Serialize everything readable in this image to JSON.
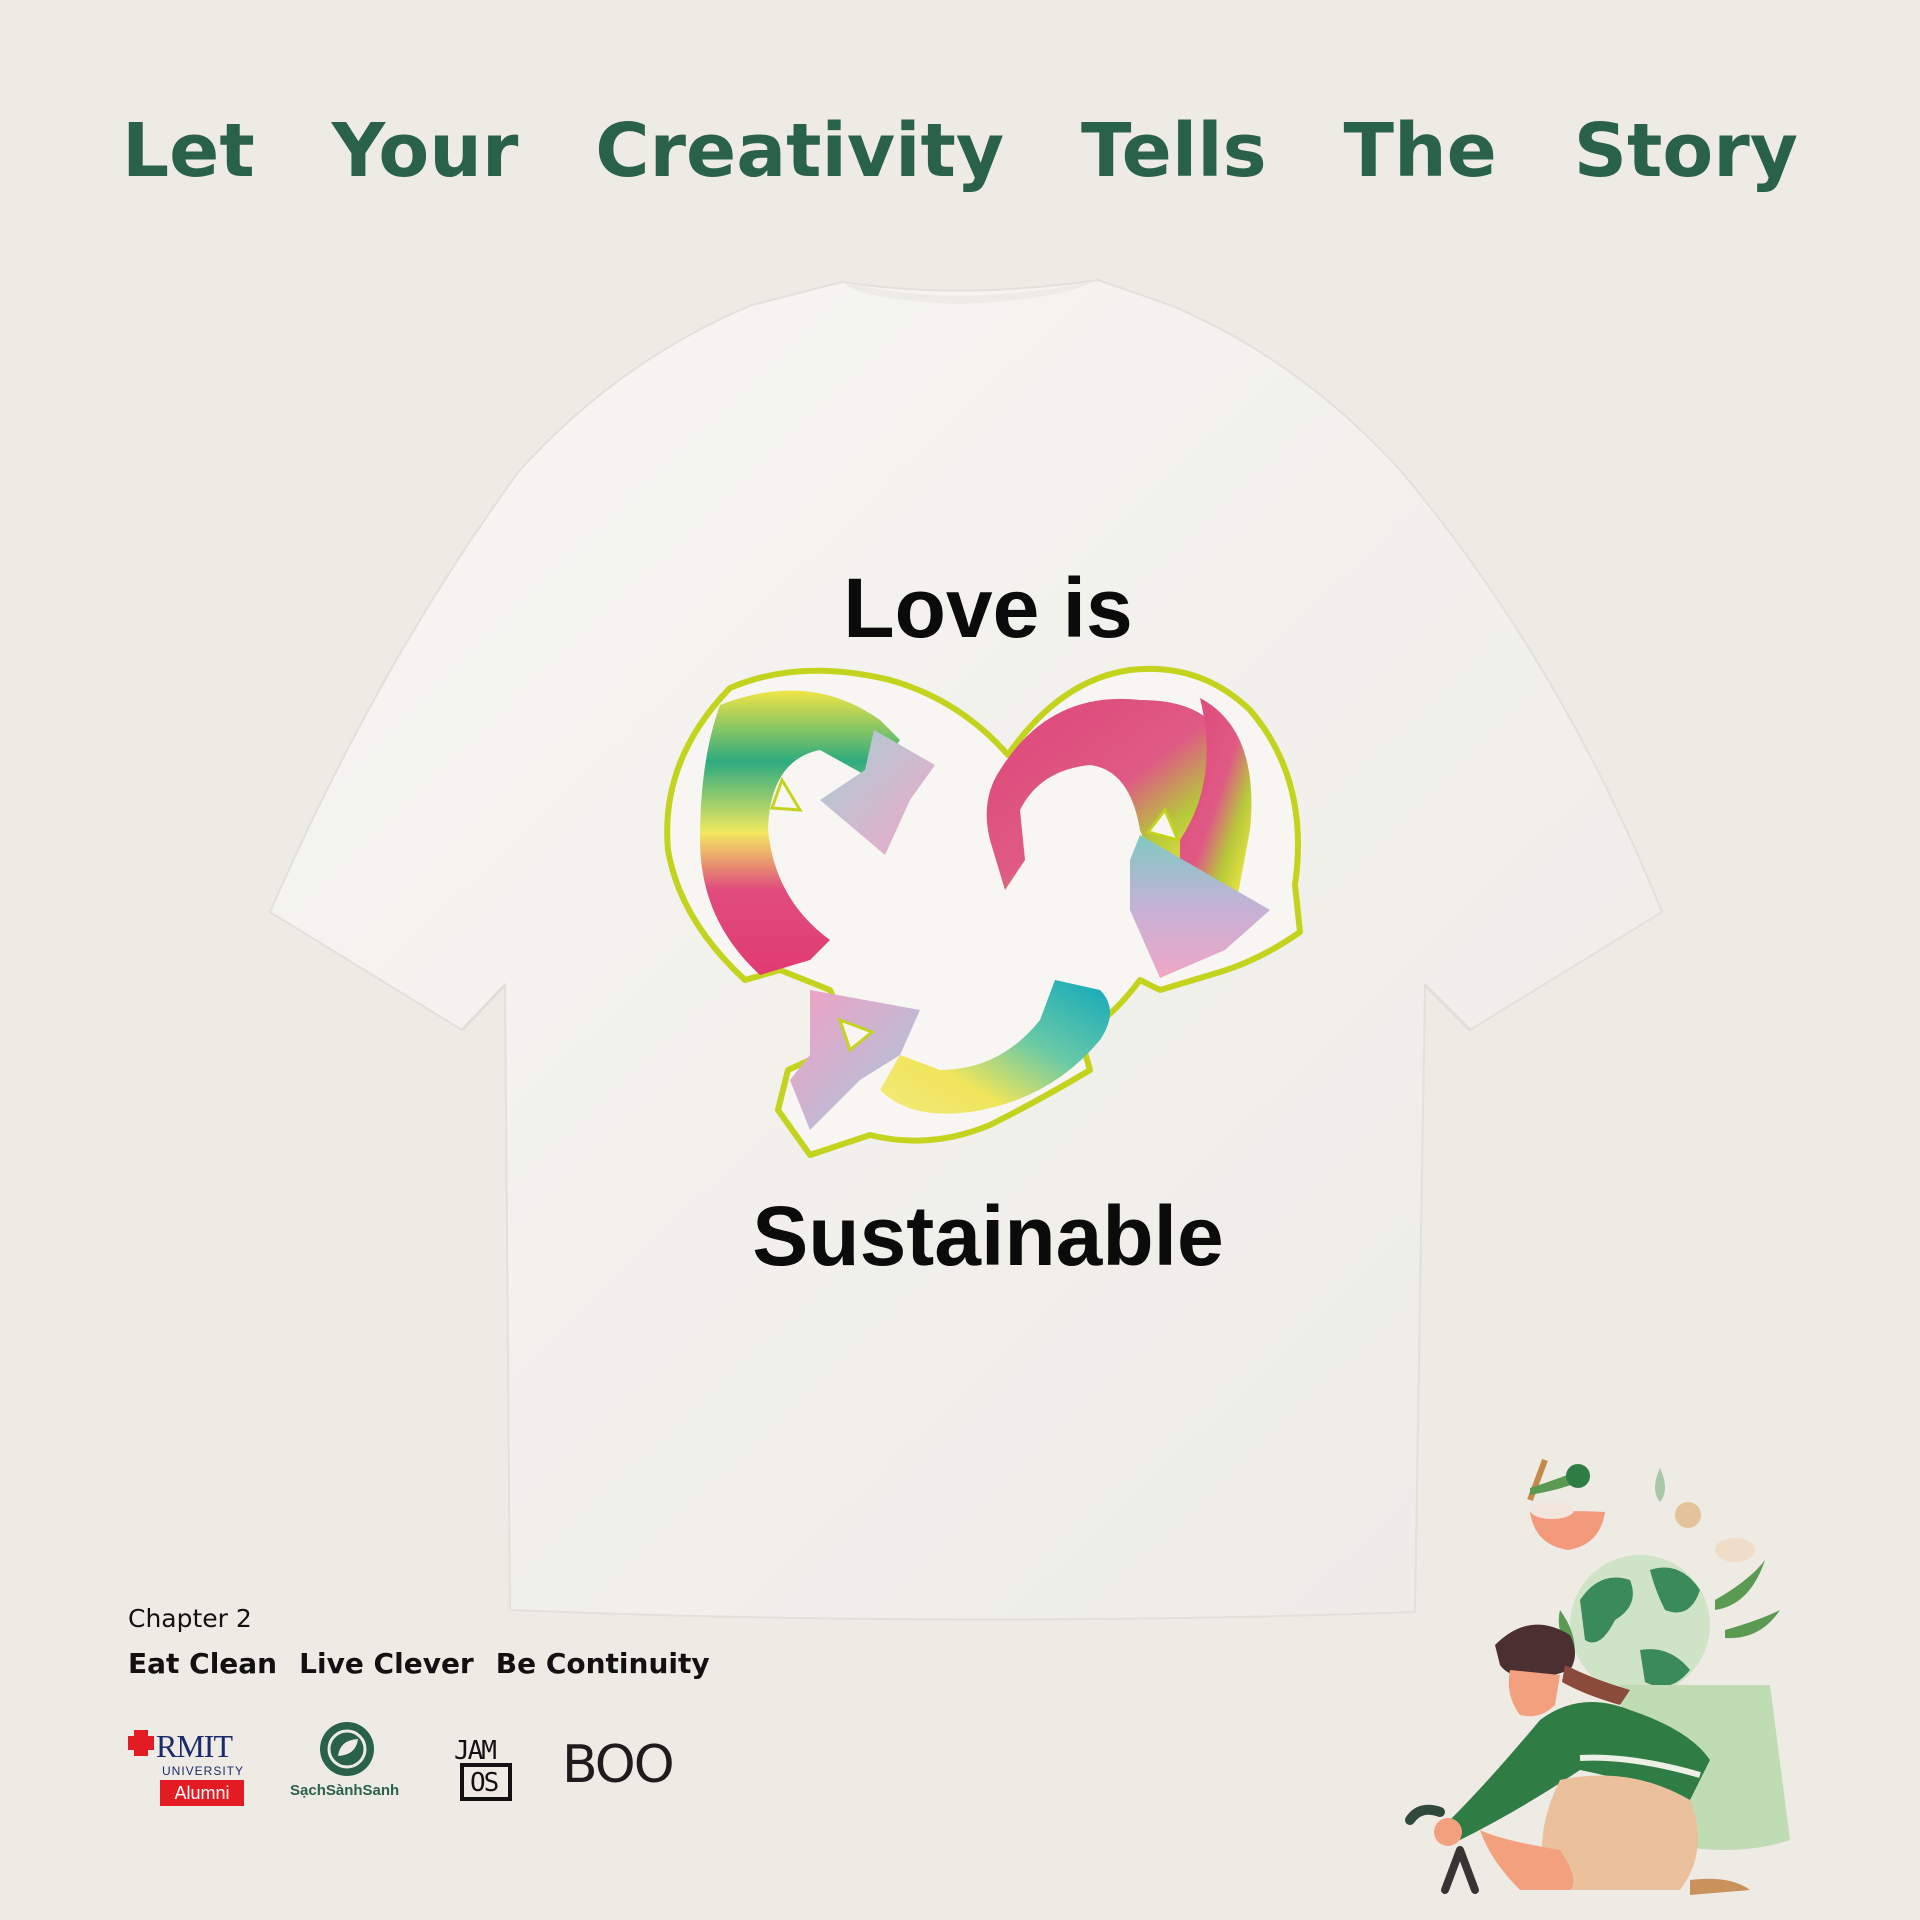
{
  "headline": {
    "words": [
      "Let",
      "Your",
      "Creativity",
      "Tells",
      "The",
      "Story"
    ]
  },
  "shirt_print": {
    "line1": "Love is",
    "line2": "Sustainable"
  },
  "footer": {
    "chapter": "Chapter 2",
    "taglines": [
      "Eat Clean",
      "Live Clever",
      "Be Continuity"
    ]
  },
  "logos": {
    "rmit": {
      "word": "RMIT",
      "sub": "UNIVERSITY",
      "badge": "Alumni"
    },
    "sachsanhsanh": {
      "name": "SạchSànhSanh"
    },
    "jamos": {
      "line1": "JAM",
      "line2": "OS"
    },
    "boo": {
      "text": "BOO"
    }
  },
  "colors": {
    "background": "#eeebe5",
    "headline": "#2a6249",
    "shirt": "#f4f3ef",
    "outline": "#c4d31e",
    "pink": "#de4579",
    "teal": "#11a8bd",
    "yellow": "#e9e85a"
  }
}
